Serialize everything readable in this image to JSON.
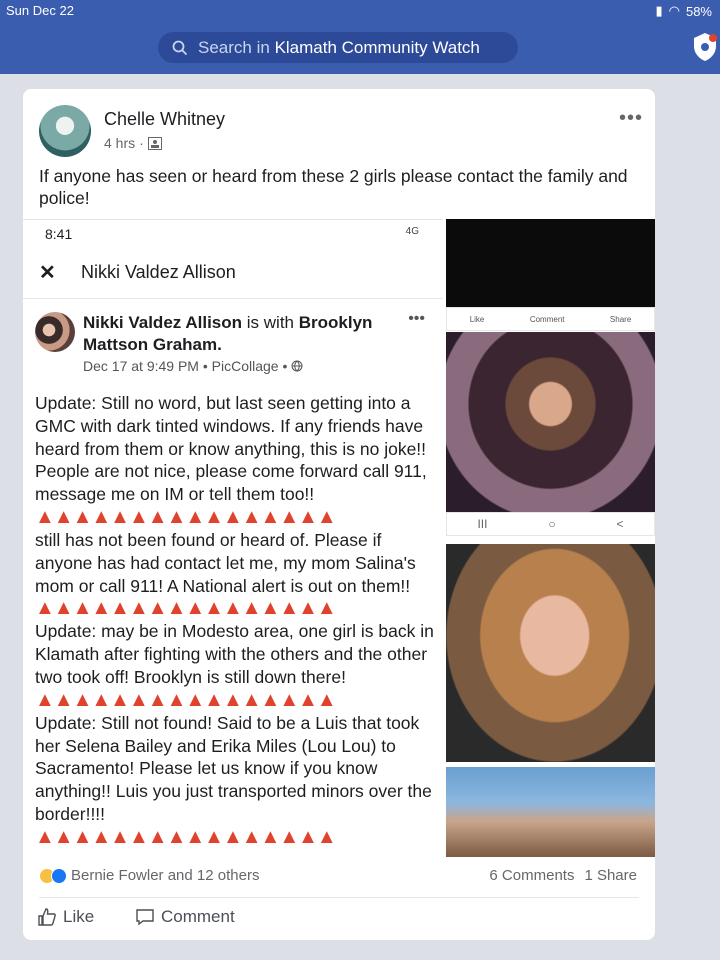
{
  "status_bar": {
    "time": "Sun Dec 22",
    "battery": "58%"
  },
  "search": {
    "prefix": "Search in",
    "group": "Klamath Community Watch"
  },
  "post": {
    "author": "Chelle Whitney",
    "time": "4 hrs",
    "text": "If anyone has seen or heard from these 2 girls please contact the family and police!",
    "more": "•••"
  },
  "shared_screenshot": {
    "time": "8:41",
    "signal": "4G",
    "header_title": "Nikki Valdez Allison",
    "author_name": "Nikki Valdez Allison",
    "with_text": "is with",
    "tagged": "Brooklyn Mattson Graham.",
    "meta": "Dec 17 at 9:49 PM • PicCollage •",
    "triangles": "▲▲▲▲▲▲▲▲▲▲▲▲▲▲▲▲",
    "para1": "Update: Still no word, but last seen getting into a GMC with dark tinted windows. If any friends have heard from them or know anything, this is no joke!! People are not nice, please come forward call 911, message me on IM or tell them too!!",
    "para2": "still has not been found or heard of. Please if anyone has had contact let me, my mom Salina's mom or call 911! A National alert is out on them!!",
    "para3": "Update: may be in Modesto area, one girl is back in Klamath after fighting with the others and the other two took off! Brooklyn is still down there!",
    "para4": "Update: Still not found! Said to be a Luis that took her Selena Bailey and Erika Miles (Lou Lou) to Sacramento! Please let us know if you know anything!! Luis you just transported minors over the border!!!!"
  },
  "photo_actions": {
    "like": "Like",
    "comment": "Comment",
    "share": "Share"
  },
  "photo_nav": {
    "recents": "III",
    "home": "○",
    "back": "<"
  },
  "footer": {
    "reactions_text": "Bernie Fowler and 12 others",
    "comments": "6 Comments",
    "shares": "1 Share",
    "like_label": "Like",
    "comment_label": "Comment"
  }
}
